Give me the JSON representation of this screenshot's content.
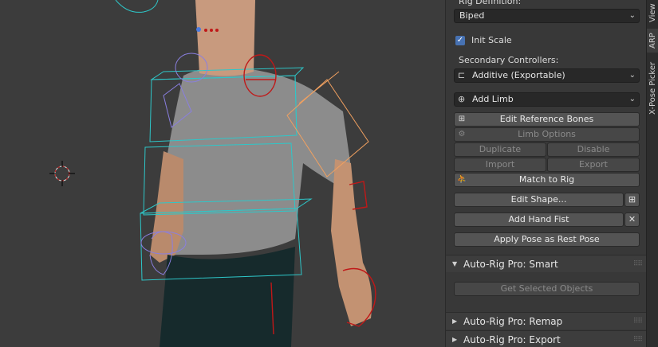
{
  "panel": {
    "rig_definition_label": "Rig Definition:",
    "rig_definition_value": "Biped",
    "init_scale_label": "Init Scale",
    "init_scale_checked": true,
    "secondary_controllers_label": "Secondary Controllers:",
    "secondary_controllers_value": "Additive (Exportable)",
    "add_limb_label": "Add Limb",
    "edit_reference_bones_label": "Edit Reference Bones",
    "limb_options_label": "Limb Options",
    "duplicate_label": "Duplicate",
    "disable_label": "Disable",
    "import_label": "Import",
    "export_label": "Export",
    "match_to_rig_label": "Match to Rig",
    "edit_shape_label": "Edit Shape...",
    "add_hand_fist_label": "Add Hand Fist",
    "apply_pose_label": "Apply Pose as Rest Pose",
    "smart_section_title": "Auto-Rig Pro: Smart",
    "get_selected_objects_label": "Get Selected Objects",
    "remap_section_title": "Auto-Rig Pro: Remap",
    "export_section_title": "Auto-Rig Pro: Export"
  },
  "sidetabs": [
    "View",
    "ARP",
    "X-Pose Picker"
  ],
  "active_tab": "ARP",
  "colors": {
    "accent": "#4772b3",
    "rig_cyan": "#2ec7c9",
    "rig_red": "#c01818",
    "rig_orange": "#f0a060",
    "rig_purple": "#8a7fe0"
  }
}
